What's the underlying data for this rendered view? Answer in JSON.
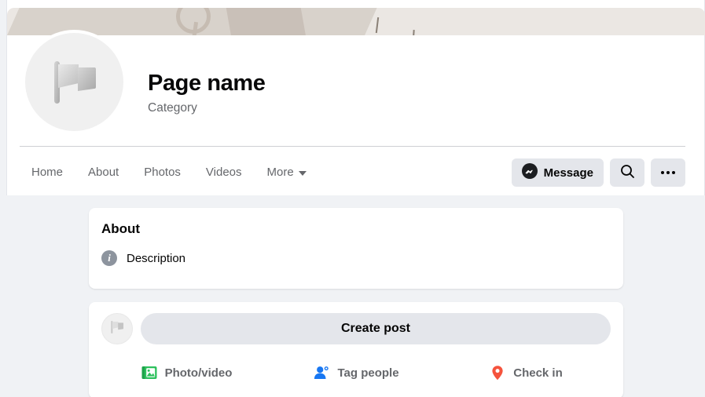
{
  "cover": {
    "name": "cover-photo"
  },
  "profile": {
    "avatar_icon": "flag-placeholder-icon",
    "name": "Page name",
    "category": "Category"
  },
  "nav": {
    "tabs": [
      {
        "label": "Home",
        "icon": null
      },
      {
        "label": "About",
        "icon": null
      },
      {
        "label": "Photos",
        "icon": null
      },
      {
        "label": "Videos",
        "icon": null
      },
      {
        "label": "More",
        "icon": "chevron-down-icon"
      }
    ],
    "actions": {
      "message_label": "Message",
      "message_icon": "messenger-icon",
      "search_icon": "search-icon",
      "more_icon": "ellipsis-icon"
    }
  },
  "about_card": {
    "heading": "About",
    "description_icon": "info-icon",
    "description": "Description"
  },
  "composer": {
    "avatar_icon": "flag-placeholder-icon",
    "placeholder": "Create post",
    "actions": [
      {
        "label": "Photo/video",
        "icon": "photo-video-icon",
        "color": "#45bd62"
      },
      {
        "label": "Tag people",
        "icon": "tag-people-icon",
        "color": "#1877f2"
      },
      {
        "label": "Check in",
        "icon": "location-pin-icon",
        "color": "#f5533d"
      }
    ]
  },
  "colors": {
    "page_background": "#f0f2f5",
    "surface": "#ffffff",
    "button_grey": "#e4e6eb",
    "text_primary": "#050505",
    "text_secondary": "#65676b",
    "cover_base": "#ebe7e3",
    "cover_accent": "#d8d2cb"
  }
}
